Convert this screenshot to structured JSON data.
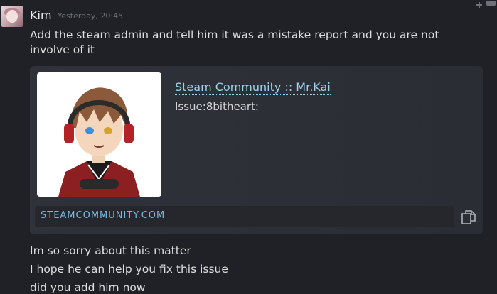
{
  "message": {
    "sender": "Kim",
    "timestamp": "Yesterday, 20:45",
    "lines_top": [
      "Add the steam admin and tell him it was a mistake report and you are not",
      "involve of it"
    ],
    "lines_bottom": [
      "Im so sorry about this matter",
      "I hope he can help you fix this issue",
      "did you add him now"
    ]
  },
  "embed": {
    "title": "Steam Community :: Mr.Kai",
    "description": "Issue:8bitheart:",
    "domain": "STEAMCOMMUNITY.COM",
    "copy_icon": "copy-icon"
  },
  "colors": {
    "background": "#1f2126",
    "link": "#9fd0ec",
    "domain": "#78b8dc"
  }
}
